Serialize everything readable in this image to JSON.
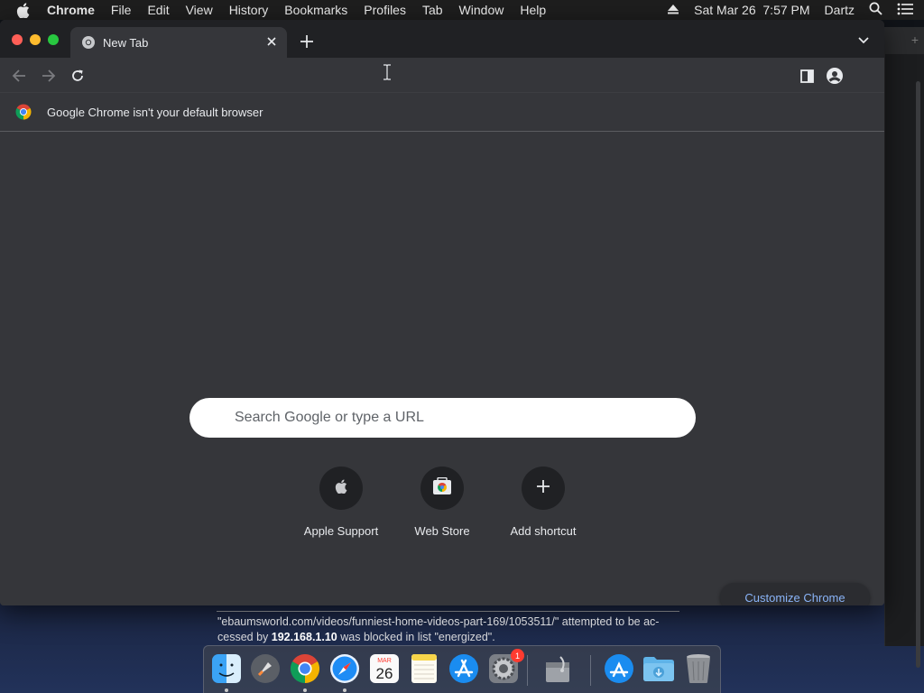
{
  "menubar": {
    "app_name": "Chrome",
    "items": [
      "File",
      "Edit",
      "View",
      "History",
      "Bookmarks",
      "Profiles",
      "Tab",
      "Window",
      "Help"
    ],
    "datetime": "Sat Mar 26  7:57 PM",
    "user": "Dartz"
  },
  "tab": {
    "title": "New Tab"
  },
  "infobar": {
    "message": "Google Chrome isn't your default browser"
  },
  "search": {
    "placeholder": "Search Google or type a URL"
  },
  "shortcuts": [
    {
      "label": "Apple Support",
      "icon": "apple-icon"
    },
    {
      "label": "Web Store",
      "icon": "web-store-icon"
    },
    {
      "label": "Add shortcut",
      "icon": "plus-icon"
    }
  ],
  "customize": {
    "label": "Customize Chrome"
  },
  "blocked_notice": {
    "url": "\"ebaumsworld.com/videos/funniest-home-videos-part-169/1053511/\"",
    "text_1": " attempted to be ac-",
    "text_2": "cessed by ",
    "ip": "192.168.1.10",
    "text_3": " was blocked in list \"energized\"."
  },
  "dock": {
    "calendar_month": "MAR",
    "calendar_day": "26",
    "settings_badge": "1",
    "icons": [
      "finder-icon",
      "launchpad-icon",
      "chrome-icon",
      "safari-icon",
      "calendar-icon",
      "notes-icon",
      "app-store-icon",
      "system-preferences-icon",
      "disk-utility-icon",
      "applications-folder-icon",
      "downloads-folder-icon",
      "trash-icon"
    ]
  },
  "colors": {
    "chrome_bg": "#35363a",
    "tabstrip_bg": "#202124",
    "link_blue": "#8ab4f8",
    "menubar_bg": "#1e1e1e"
  }
}
